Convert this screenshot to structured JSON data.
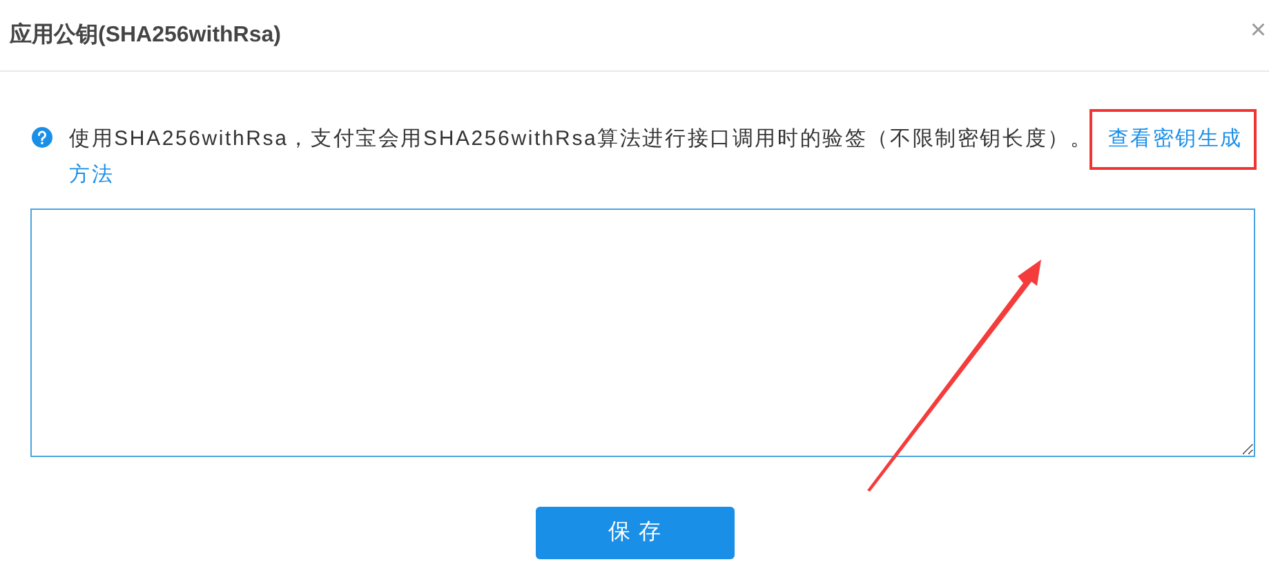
{
  "dialog": {
    "title": "应用公钥(SHA256withRsa)",
    "close": "×"
  },
  "notice": {
    "text": "使用SHA256withRsa，支付宝会用SHA256withRsa算法进行接口调用时的验签（不限制密钥长度）。",
    "link_lines": [
      "查看密钥生成",
      "方法"
    ]
  },
  "buttons": [
    {
      "label": "保存"
    }
  ]
}
